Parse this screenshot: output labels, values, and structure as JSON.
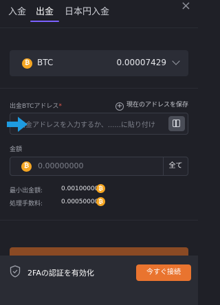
{
  "tabs": [
    {
      "label": "入金",
      "active": false
    },
    {
      "label": "出金",
      "active": true
    },
    {
      "label": "日本円入金",
      "active": false
    }
  ],
  "close_label": "×",
  "coin": {
    "symbol": "BTC",
    "icon_glyph": "₿",
    "balance": "0.00007429"
  },
  "address": {
    "label": "出金BTCアドレス",
    "required_mark": "*",
    "save_label": "現在のアドレスを保存",
    "placeholder": "出金アドレスを入力するか、......に貼り付け"
  },
  "amount": {
    "label": "金額",
    "placeholder": "0.00000000",
    "all_label": "全て"
  },
  "limits": {
    "min_label": "最小出金額:",
    "min_value": "0.00100000",
    "fee_label": "処理手数料:",
    "fee_value": "0.00050000"
  },
  "banner": {
    "text": "2FAの認証を有効化",
    "button_label": "今すぐ接続"
  },
  "colors": {
    "accent": "#7b61ff",
    "coin": "#f5a623",
    "cta": "#e9742f",
    "arrow": "#1e9be0"
  }
}
